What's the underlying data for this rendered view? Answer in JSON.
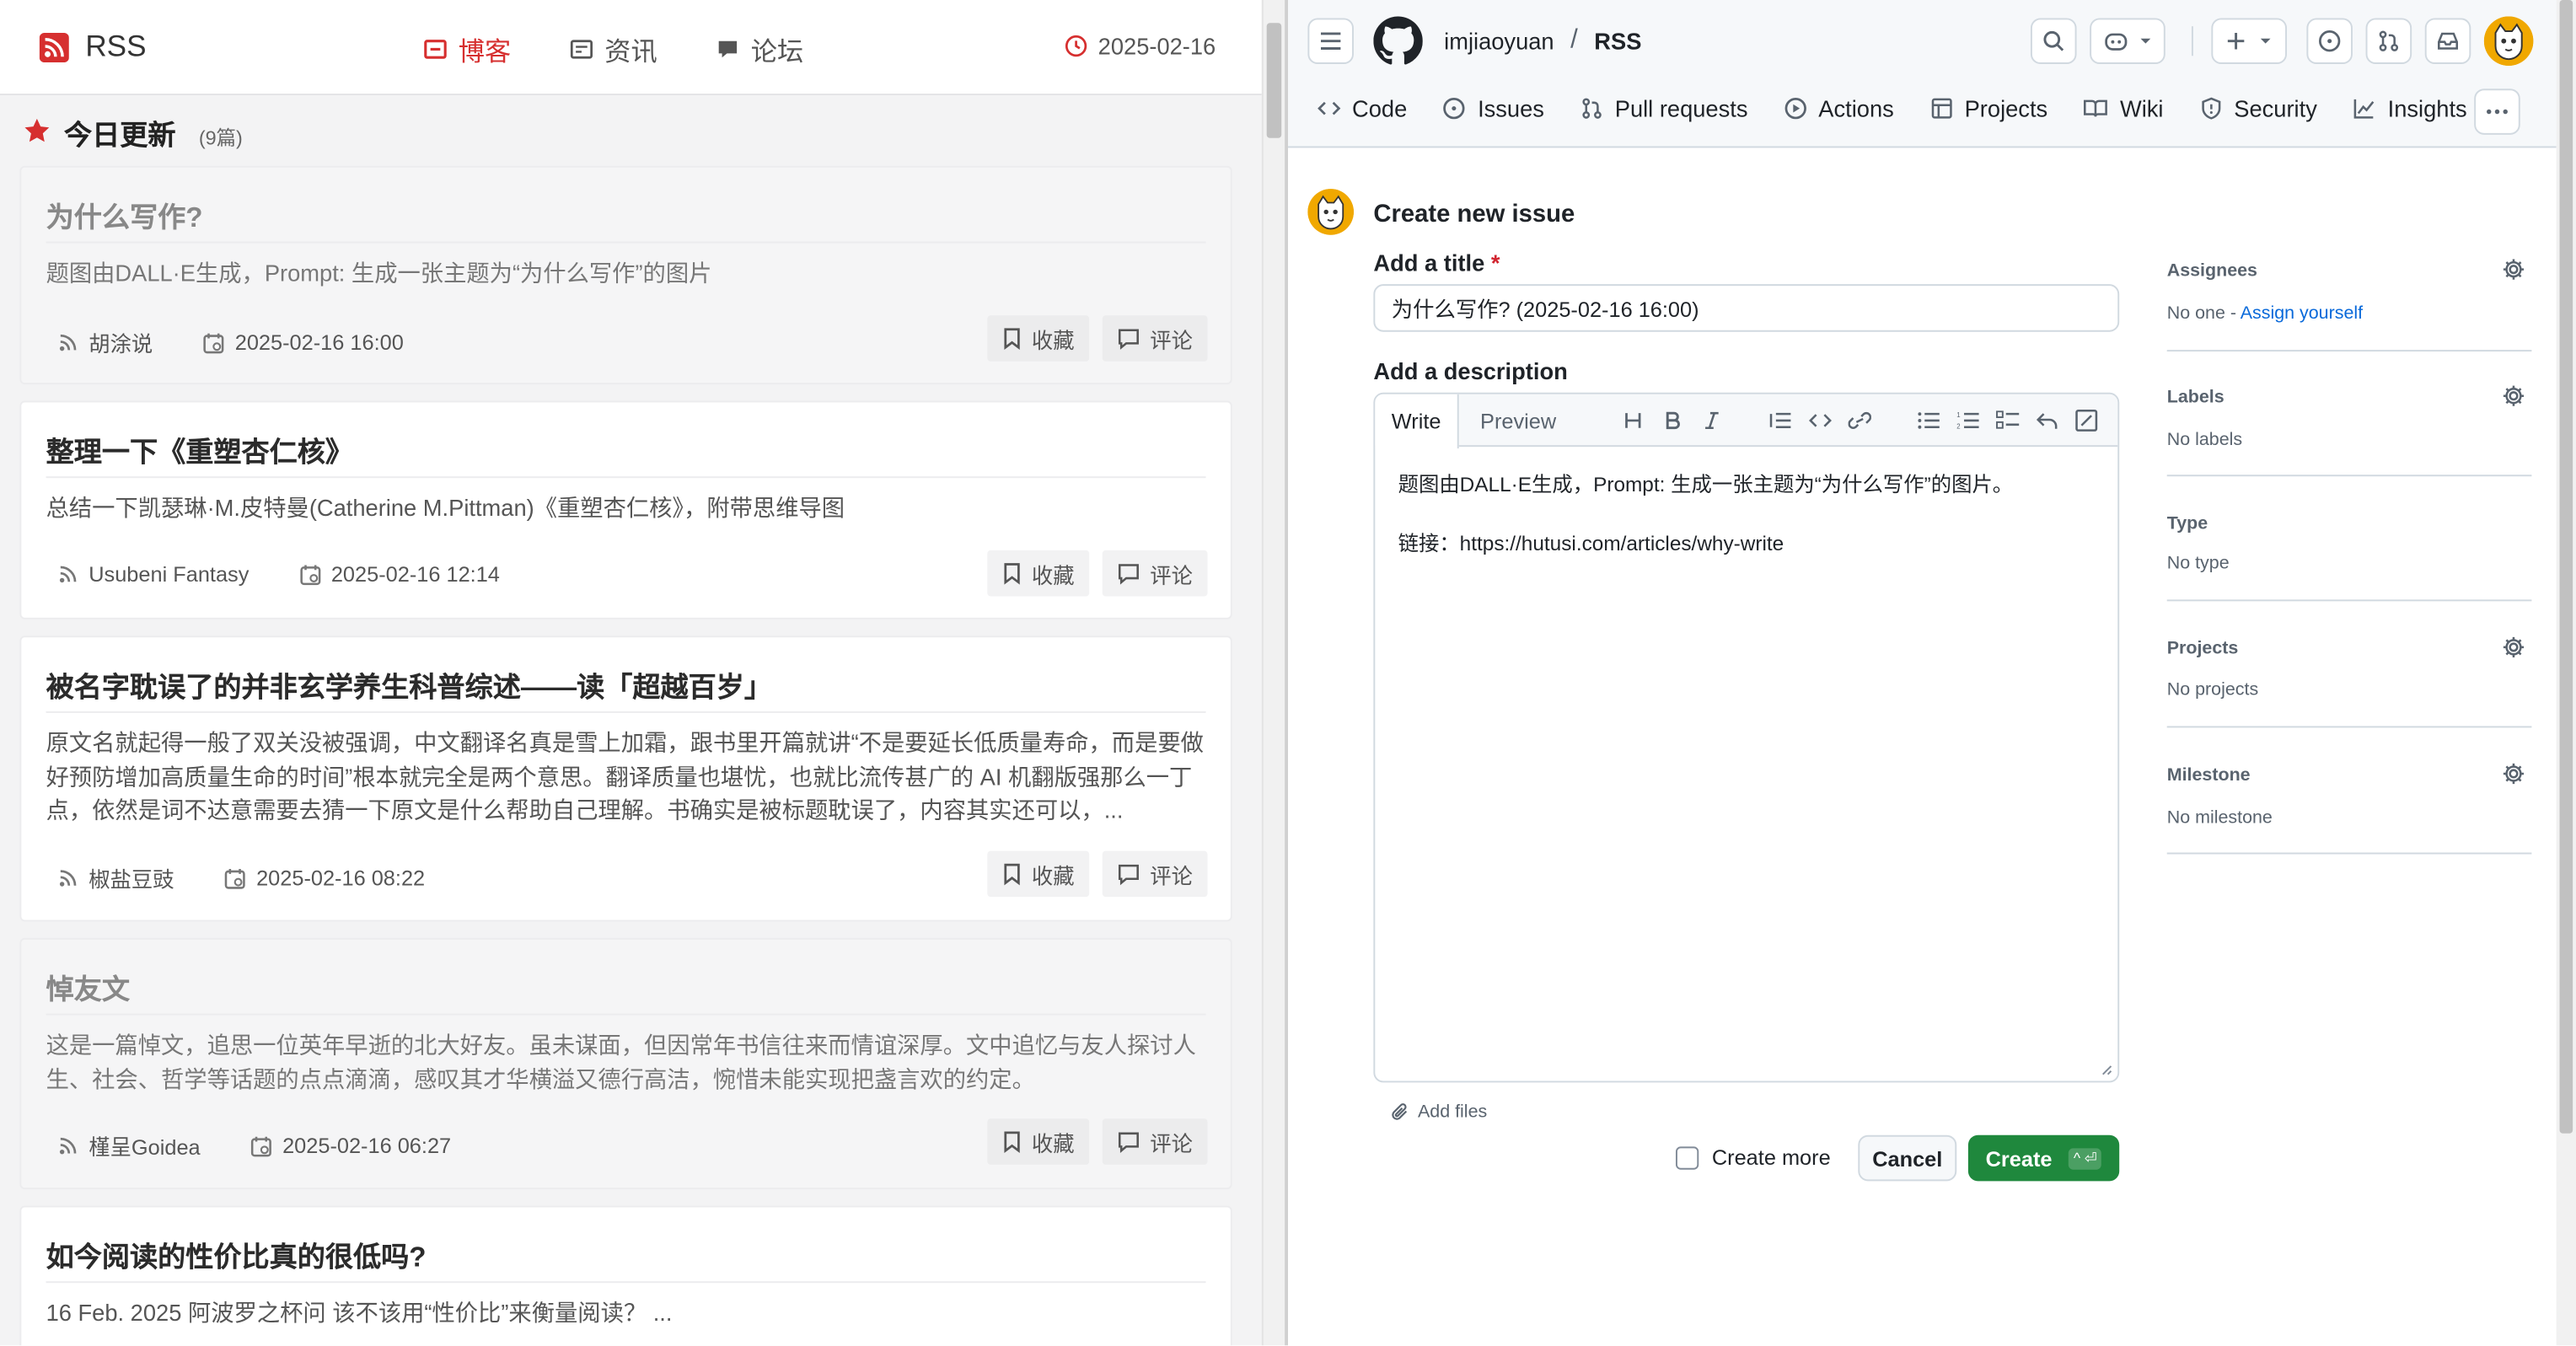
{
  "rss": {
    "brand": "RSS",
    "nav": [
      {
        "label": "博客",
        "active": true
      },
      {
        "label": "资讯",
        "active": false
      },
      {
        "label": "论坛",
        "active": false
      }
    ],
    "date": "2025-02-16",
    "today_title": "今日更新",
    "today_count": "(9篇)",
    "collect_label": "收藏",
    "comment_label": "评论",
    "articles": [
      {
        "title": "为什么写作?",
        "desc": "题图由DALL·E生成，Prompt: 生成一张主题为“为什么写作”的图片",
        "source": "胡涂说",
        "time": "2025-02-16 16:00",
        "faded": true
      },
      {
        "title": "整理一下《重塑杏仁核》",
        "desc": "总结一下凯瑟琳·M.皮特曼(Catherine M.Pittman)《重塑杏仁核》，附带思维导图",
        "source": "Usubeni Fantasy",
        "time": "2025-02-16 12:14",
        "faded": false
      },
      {
        "title": "被名字耽误了的并非玄学养生科普综述——读「超越百岁」",
        "desc": "原文名就起得一般了双关没被强调，中文翻译名真是雪上加霜，跟书里开篇就讲“不是要延长低质量寿命，而是要做好预防增加高质量生命的时间”根本就完全是两个意思。翻译质量也堪忧，也就比流传甚广的 AI 机翻版强那么一丁点，依然是词不达意需要去猜一下原文是什么帮助自己理解。书确实是被标题耽误了，内容其实还可以，...",
        "source": "椒盐豆豉",
        "time": "2025-02-16 08:22",
        "faded": false
      },
      {
        "title": "悼友文",
        "desc": "这是一篇悼文，追思一位英年早逝的北大好友。虽未谋面，但因常年书信往来而情谊深厚。文中追忆与友人探讨人生、社会、哲学等话题的点点滴滴，感叹其才华横溢又德行高洁，惋惜未能实现把盏言欢的约定。",
        "source": "槿呈Goidea",
        "time": "2025-02-16 06:27",
        "faded": true
      },
      {
        "title": "如今阅读的性价比真的很低吗?",
        "desc": "16 Feb. 2025  阿波罗之杯问 该不该用“性价比”来衡量阅读？ ...",
        "source": "",
        "time": "",
        "faded": false
      }
    ]
  },
  "github": {
    "owner": "imjiaoyuan",
    "repo": "RSS",
    "tabs": [
      "Code",
      "Issues",
      "Pull requests",
      "Actions",
      "Projects",
      "Wiki",
      "Security",
      "Insights"
    ],
    "page_title": "Create new issue",
    "title_label": "Add a title",
    "required_mark": "*",
    "title_value": "为什么写作?  (2025-02-16 16:00)",
    "desc_label": "Add a description",
    "editor_tabs": {
      "write": "Write",
      "preview": "Preview"
    },
    "body_line1": "题图由DALL·E生成，Prompt: 生成一张主题为“为什么写作”的图片。",
    "body_line2": "链接：https://hutusi.com/articles/why-write",
    "add_files": "Add files",
    "create_more": "Create more",
    "cancel": "Cancel",
    "create": "Create",
    "create_shortcut": "^ ⏎",
    "sidebar": {
      "assignees": {
        "label": "Assignees",
        "value": "No one - ",
        "link": "Assign yourself"
      },
      "labels": {
        "label": "Labels",
        "value": "No labels"
      },
      "type": {
        "label": "Type",
        "value": "No type"
      },
      "projects": {
        "label": "Projects",
        "value": "No projects"
      },
      "milestone": {
        "label": "Milestone",
        "value": "No milestone"
      }
    }
  }
}
